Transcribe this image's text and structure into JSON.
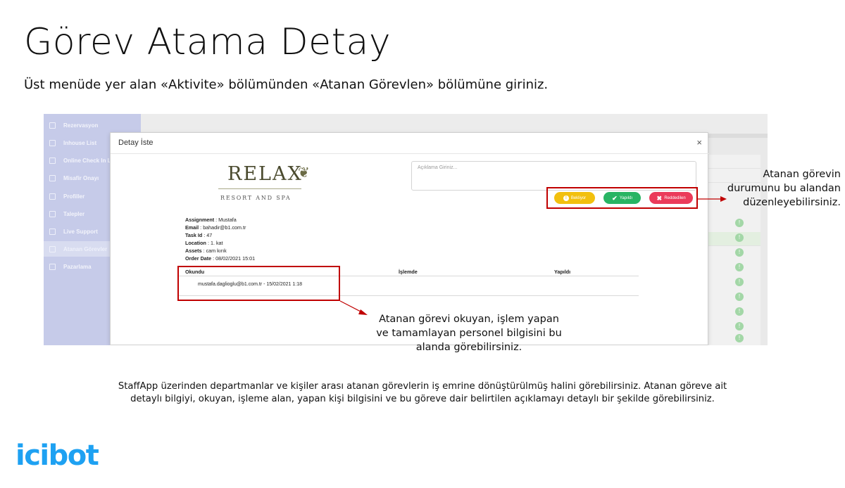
{
  "slide": {
    "title": "Görev Atama Detay",
    "subtitle": "Üst menüde yer alan «Aktivite» bölümünden «Atanan Görevlen» bölümüne giriniz.",
    "footer_line1": "StaffApp üzerinden departmanlar ve kişiler arası atanan görevlerin iş emrine dönüştürülmüş halini görebilirsiniz. Atanan göreve ait",
    "footer_line2": "detaylı bilgiyi, okuyan, işleme alan, yapan kişi bilgisini ve bu göreve dair belirtilen açıklamayı detaylı bir şekilde görebilirsiniz.",
    "brand": "icibot"
  },
  "callouts": {
    "status_line1": "Atanan görevin",
    "status_line2": "durumunu bu alandan",
    "status_line3": "düzenleyebilirsiniz.",
    "readers_line1": "Atanan görevi okuyan, işlem yapan",
    "readers_line2": "ve tamamlayan personel bilgisini bu",
    "readers_line3": "alanda görebilirsiniz."
  },
  "sidebar": {
    "items": [
      {
        "label": "Rezervasyon",
        "icon": "list-icon"
      },
      {
        "label": "Inhouse List",
        "icon": "list-icon"
      },
      {
        "label": "Online Check In List",
        "icon": "list-icon"
      },
      {
        "label": "Misafir Onayı",
        "icon": "list-icon"
      },
      {
        "label": "Profiller",
        "icon": "list-icon"
      },
      {
        "label": "Talepler",
        "icon": "list-icon"
      },
      {
        "label": "Live Support",
        "icon": "list-icon"
      },
      {
        "label": "Atanan Görevler",
        "icon": "list-icon",
        "active": true
      },
      {
        "label": "Pazarlama",
        "icon": "list-icon"
      }
    ]
  },
  "modal": {
    "title": "Detay İste",
    "close": "×",
    "logo_main": "RELAX",
    "logo_sub": "RESORT AND SPA",
    "description_placeholder": "Açıklama Giriniz...",
    "buttons": {
      "pending": "Bekliyor",
      "done": "Yapıldı",
      "rejected": "Reddedilen"
    },
    "info": [
      {
        "label": "Assignment",
        "value": "Mustafa"
      },
      {
        "label": "Email",
        "value": "bahadir@b1.com.tr"
      },
      {
        "label": "Task Id",
        "value": "47"
      },
      {
        "label": "Location",
        "value": "1. kat"
      },
      {
        "label": "Assets",
        "value": "cam kırık"
      },
      {
        "label": "Order Date",
        "value": "08/02/2021 15:01"
      }
    ],
    "table": {
      "headers": [
        "Okundu",
        "İşlemde",
        "Yapıldı"
      ],
      "okundu_value": "mustafa.daglioglu@b1.com.tr - 15/02/2021 1:18"
    }
  },
  "colors": {
    "pending": "#f2c00e",
    "done": "#28b463",
    "rejected": "#eb3b5a",
    "callout_red": "#c00000",
    "brand_blue": "#1ea1f2"
  }
}
